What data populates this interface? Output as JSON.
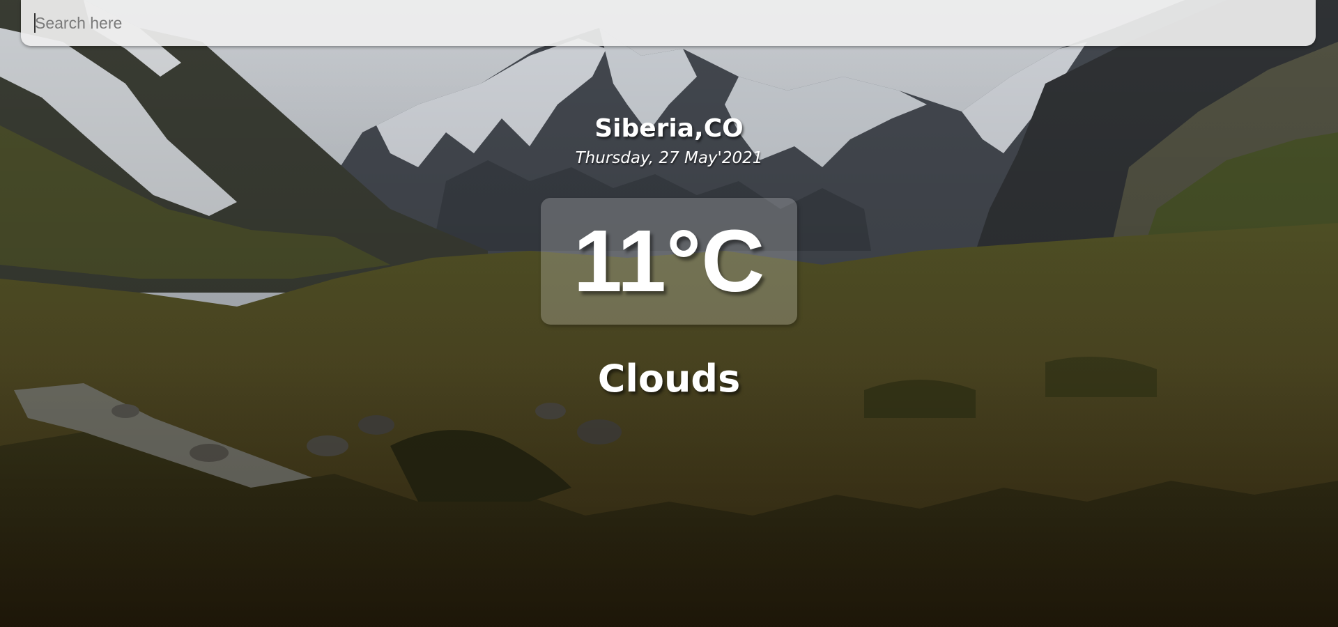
{
  "search": {
    "placeholder": "Search here",
    "value": ""
  },
  "weather": {
    "location": "Siberia,CO",
    "date": "Thursday, 27 May'2021",
    "temperature": "11°C",
    "condition": "Clouds"
  },
  "background": {
    "description_icon": "mountain-valley-photo",
    "colors": {
      "sky": "#c9cdd2",
      "snow": "#e6e9ee",
      "rock": "#3e4249",
      "grass": "#5a5a2a",
      "shrub": "#3a3416"
    }
  }
}
